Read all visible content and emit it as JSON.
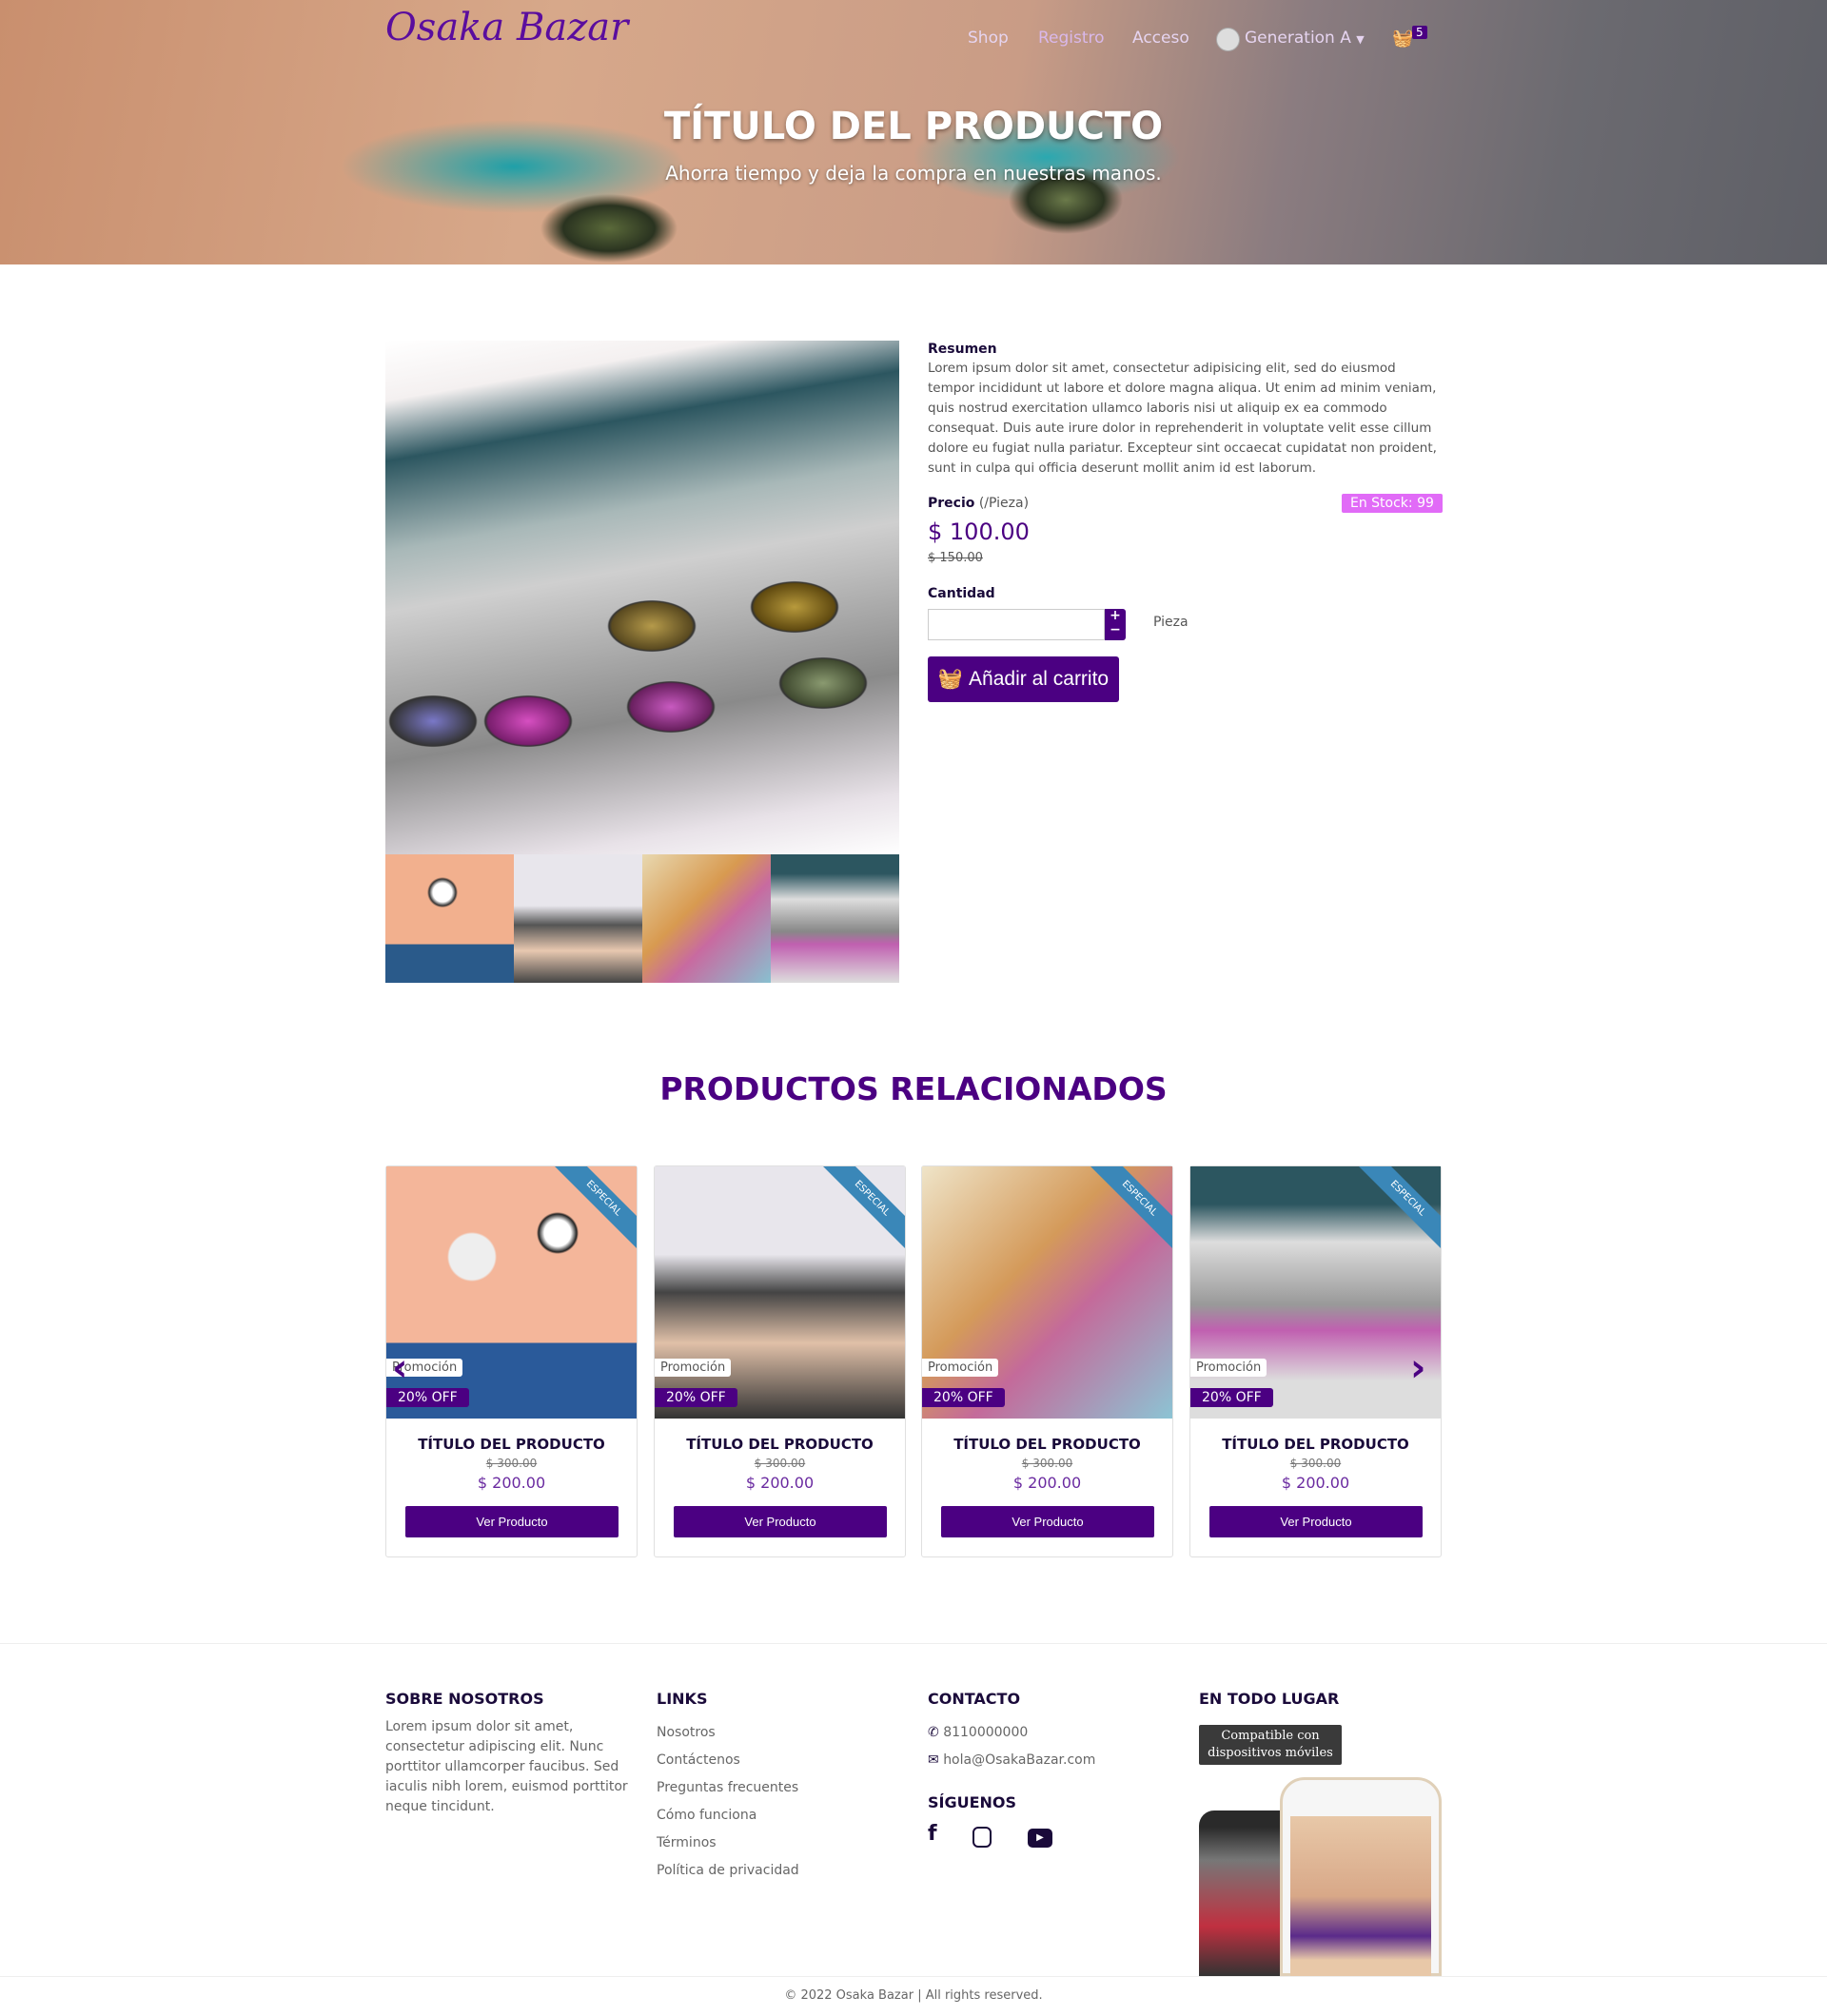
{
  "header": {
    "logo": "Osaka Bazar",
    "nav": [
      "Shop",
      "Registro",
      "Acceso"
    ],
    "user": "Generation A",
    "cart_count": "5"
  },
  "hero": {
    "title": "TÍTULO DEL PRODUCTO",
    "subtitle": "Ahorra tiempo y deja la compra en nuestras manos."
  },
  "product": {
    "summary_label": "Resumen",
    "summary": "Lorem ipsum dolor sit amet, consectetur adipisicing elit, sed do eiusmod tempor incididunt ut labore et dolore magna aliqua. Ut enim ad minim veniam, quis nostrud exercitation ullamco laboris nisi ut aliquip ex ea commodo consequat. Duis aute irure dolor in reprehenderit in voluptate velit esse cillum dolore eu fugiat nulla pariatur. Excepteur sint occaecat cupidatat non proident, sunt in culpa qui officia deserunt mollit anim id est laborum.",
    "price_label": "Precio",
    "price_unit": "(/Pieza)",
    "stock": "En Stock: 99",
    "price": "$ 100.00",
    "old_price": "$ 150.00",
    "qty_label": "Cantidad",
    "qty_value": "",
    "unit": "Pieza",
    "add_to_cart": "Añadir al carrito"
  },
  "related": {
    "title": "PRODUCTOS RELACIONADOS",
    "cards": [
      {
        "ribbon": "ESPECIAL",
        "promo": "Promoción",
        "off": "20% OFF",
        "title": "TÍTULO DEL PRODUCTO",
        "old": "$ 300.00",
        "price": "$ 200.00",
        "button": "Ver Producto"
      },
      {
        "ribbon": "ESPECIAL",
        "promo": "Promoción",
        "off": "20% OFF",
        "title": "TÍTULO DEL PRODUCTO",
        "old": "$ 300.00",
        "price": "$ 200.00",
        "button": "Ver Producto"
      },
      {
        "ribbon": "ESPECIAL",
        "promo": "Promoción",
        "off": "20% OFF",
        "title": "TÍTULO DEL PRODUCTO",
        "old": "$ 300.00",
        "price": "$ 200.00",
        "button": "Ver Producto"
      },
      {
        "ribbon": "ESPECIAL",
        "promo": "Promoción",
        "off": "20% OFF",
        "title": "TÍTULO DEL PRODUCTO",
        "old": "$ 300.00",
        "price": "$ 200.00",
        "button": "Ver Producto"
      }
    ]
  },
  "footer": {
    "about_title": "SOBRE NOSOTROS",
    "about": "Lorem ipsum dolor sit amet, consectetur adipiscing elit. Nunc porttitor ullamcorper faucibus. Sed iaculis nibh lorem, euismod porttitor neque tincidunt.",
    "links_title": "LINKS",
    "links": [
      "Nosotros",
      "Contáctenos",
      "Preguntas frecuentes",
      "Cómo funciona",
      "Términos",
      "Política de privacidad"
    ],
    "contact_title": "CONTACTO",
    "phone": "8110000000",
    "email": "hola@OsakaBazar.com",
    "follow_title": "SÍGUENOS",
    "everywhere_title": "EN TODO LUGAR",
    "mobile_badge": "Compatible con dispositivos móviles",
    "copyright": "© 2022 Osaka Bazar | All rights reserved."
  }
}
